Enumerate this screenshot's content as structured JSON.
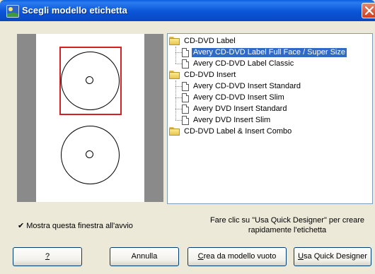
{
  "window": {
    "title": "Scegli modello etichetta"
  },
  "tree": {
    "items": [
      {
        "label": "CD-DVD Label",
        "type": "folder"
      },
      {
        "label": "Avery CD-DVD Label Full Face / Super Size",
        "type": "template",
        "selected": true
      },
      {
        "label": "Avery CD-DVD Label Classic",
        "type": "template"
      },
      {
        "label": "CD-DVD Insert",
        "type": "folder"
      },
      {
        "label": "Avery CD-DVD Insert Standard",
        "type": "template"
      },
      {
        "label": "Avery CD-DVD Insert Slim",
        "type": "template"
      },
      {
        "label": "Avery DVD Insert Standard",
        "type": "template"
      },
      {
        "label": "Avery DVD Insert Slim",
        "type": "template"
      },
      {
        "label": "CD-DVD Label & Insert Combo",
        "type": "folder"
      }
    ]
  },
  "startup_checkbox": {
    "label": "Mostra questa finestra all'avvio",
    "checked": true,
    "mark": "✔"
  },
  "info": {
    "line1": "Fare clic su \"Usa Quick Designer\" per creare",
    "line2": "rapidamente l'etichetta"
  },
  "buttons": {
    "help": {
      "label": "?"
    },
    "cancel": {
      "label": "Annulla"
    },
    "blank": {
      "mnemonic": "C",
      "rest": "rea da modello vuoto"
    },
    "quick": {
      "mnemonic": "U",
      "rest": "sa Quick Designer"
    }
  },
  "colors": {
    "selection": "#316ac5",
    "title_bar": "#0a55d8",
    "selection_frame": "#d42020"
  }
}
